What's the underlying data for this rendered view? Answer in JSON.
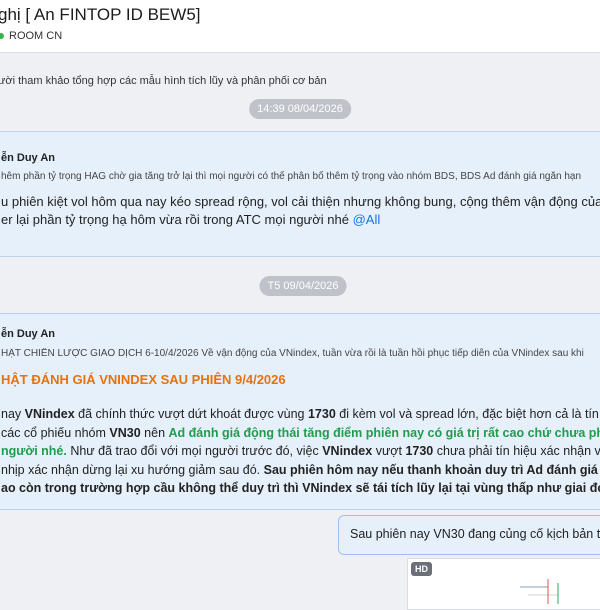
{
  "header": {
    "title": "ghị [ An FINTOP ID BEW5]",
    "room": "ROOM CN"
  },
  "pinned": "ười tham khảo tổng hợp các mẫu hình tích lũy và phân phối cơ bản",
  "dates": [
    "14:39 08/04/2026",
    "T5 09/04/2026"
  ],
  "messages": [
    {
      "author": "ễn Duy An",
      "quote": "hêm phần tỷ trọng HAG chờ gia tăng trở lại thì mọi người có thể phân bổ thêm tỷ trọng vào nhóm BDS, BDS Ad đánh giá ngắn hạn",
      "line1": "u phiên kiệt vol hôm qua nay kéo spread rộng, vol cải thiện nhưng không bung, cộng thêm vận động của VNindex",
      "line2": "er lại phần tỷ trọng hạ hôm vừa rồi trong ATC mọi người nhé ",
      "mention": "@All"
    },
    {
      "author": "ễn Duy An",
      "quote": "HẬT CHIẾN LƯỢC GIAO DỊCH 6-10/4/2026 Về vận động của VNindex, tuần vừa rồi là tuần hồi phục tiếp diễn của VNindex sau khi",
      "heading": "HẬT ĐÁNH GIÁ VNINDEX SAU PHIÊN 9/4/2026",
      "l1a": "nay ",
      "l1b": "VNindex",
      "l1c": " đã chính thức vượt dứt khoát được vùng ",
      "l1d": "1730",
      "l1e": " đi kèm vol và spread lớn, đặc biệt hơn cả là tín hiệu xá",
      "l2a": "các cổ phiếu nhóm ",
      "l2b": "VN30",
      "l2c": " nên ",
      "l2d": "Ad đánh giá động thái tăng điểm phiên nay có giá trị rất cao chứ chưa phải là 1 p",
      "l3a": " người nhé.",
      "l3b": " Như đã trao đổi với mọi người trước đó, việc ",
      "l3c": "VNindex",
      "l3d": " vượt ",
      "l3e": "1730",
      "l3f": " chưa phải tín hiệu xác nhận vào són",
      "l4a": " nhịp xác nhận dừng lại xu hướng giảm sau đó. ",
      "l4b": "Sau phiên hôm nay nếu thanh khoản duy trì Ad đánh giá VNinde",
      "l5": "ao còn trong trường hợp cầu không thể duy trì thì VNindex sẽ tái tích lũy lại tại vùng thấp như giai đoạn 2016"
    }
  ],
  "reply": "Sau phiên nay VN30 đang củng cố kịch bản tes",
  "image_badge": "HD"
}
